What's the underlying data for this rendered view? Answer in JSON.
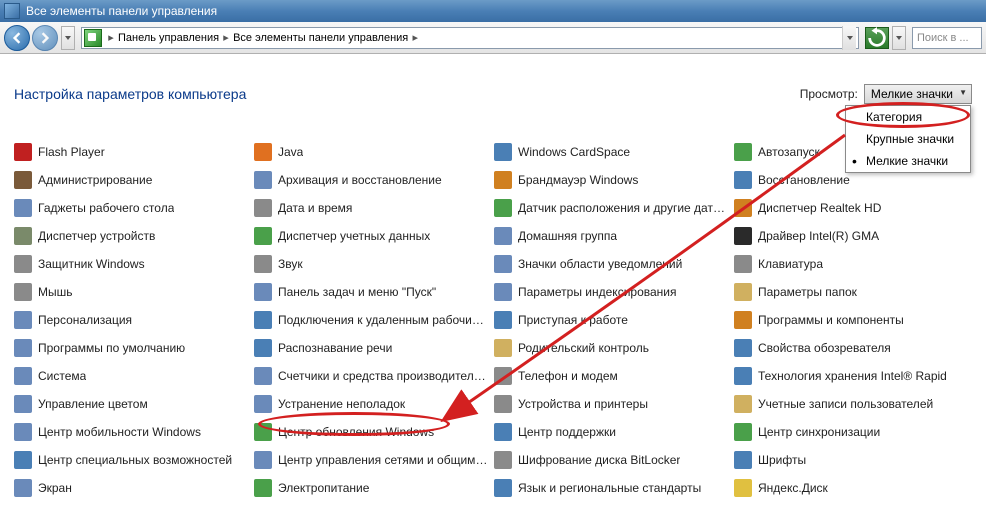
{
  "titlebar": {
    "title": "Все элементы панели управления"
  },
  "breadcrumb": {
    "seg1": "Панель управления",
    "seg2": "Все элементы панели управления"
  },
  "search": {
    "placeholder": "Поиск в ..."
  },
  "heading": "Настройка параметров компьютера",
  "view": {
    "label": "Просмотр:",
    "selected": "Мелкие значки",
    "menu": {
      "opt1": "Категория",
      "opt2": "Крупные значки",
      "opt3": "Мелкие значки"
    }
  },
  "items": [
    {
      "label": "Flash Player",
      "bg": "#c02020"
    },
    {
      "label": "Java",
      "bg": "#e07020"
    },
    {
      "label": "Windows CardSpace",
      "bg": "#4a7fb5"
    },
    {
      "label": "Автозапуск",
      "bg": "#4aa04a"
    },
    {
      "label": "Администрирование",
      "bg": "#7a5a3a"
    },
    {
      "label": "Архивация и восстановление",
      "bg": "#6a8aba"
    },
    {
      "label": "Брандмауэр Windows",
      "bg": "#d08020"
    },
    {
      "label": "Восстановление",
      "bg": "#4a7fb5"
    },
    {
      "label": "Гаджеты рабочего стола",
      "bg": "#6a8aba"
    },
    {
      "label": "Дата и время",
      "bg": "#8a8a8a"
    },
    {
      "label": "Датчик расположения и другие датч...",
      "bg": "#4aa04a"
    },
    {
      "label": "Диспетчер Realtek HD",
      "bg": "#d08020"
    },
    {
      "label": "Диспетчер устройств",
      "bg": "#7a8a6a"
    },
    {
      "label": "Диспетчер учетных данных",
      "bg": "#4aa04a"
    },
    {
      "label": "Домашняя группа",
      "bg": "#6a8aba"
    },
    {
      "label": "Драйвер Intel(R) GMA",
      "bg": "#2a2a2a"
    },
    {
      "label": "Защитник Windows",
      "bg": "#8a8a8a"
    },
    {
      "label": "Звук",
      "bg": "#8a8a8a"
    },
    {
      "label": "Значки области уведомлений",
      "bg": "#6a8aba"
    },
    {
      "label": "Клавиатура",
      "bg": "#8a8a8a"
    },
    {
      "label": "Мышь",
      "bg": "#8a8a8a"
    },
    {
      "label": "Панель задач и меню \"Пуск\"",
      "bg": "#6a8aba"
    },
    {
      "label": "Параметры индексирования",
      "bg": "#6a8aba"
    },
    {
      "label": "Параметры папок",
      "bg": "#d0b060"
    },
    {
      "label": "Персонализация",
      "bg": "#6a8aba"
    },
    {
      "label": "Подключения к удаленным рабочим с...",
      "bg": "#4a7fb5"
    },
    {
      "label": "Приступая к работе",
      "bg": "#4a7fb5"
    },
    {
      "label": "Программы и компоненты",
      "bg": "#d08020"
    },
    {
      "label": "Программы по умолчанию",
      "bg": "#6a8aba"
    },
    {
      "label": "Распознавание речи",
      "bg": "#4a7fb5"
    },
    {
      "label": "Родительский контроль",
      "bg": "#d0b060"
    },
    {
      "label": "Свойства обозревателя",
      "bg": "#4a7fb5"
    },
    {
      "label": "Система",
      "bg": "#6a8aba"
    },
    {
      "label": "Счетчики и средства производитель...",
      "bg": "#6a8aba"
    },
    {
      "label": "Телефон и модем",
      "bg": "#8a8a8a"
    },
    {
      "label": "Технология хранения Intel® Rapid",
      "bg": "#4a7fb5"
    },
    {
      "label": "Управление цветом",
      "bg": "#6a8aba"
    },
    {
      "label": "Устранение неполадок",
      "bg": "#6a8aba"
    },
    {
      "label": "Устройства и принтеры",
      "bg": "#8a8a8a"
    },
    {
      "label": "Учетные записи пользователей",
      "bg": "#d0b060"
    },
    {
      "label": "Центр мобильности Windows",
      "bg": "#6a8aba"
    },
    {
      "label": "Центр обновления Windows",
      "bg": "#4aa04a"
    },
    {
      "label": "Центр поддержки",
      "bg": "#4a7fb5"
    },
    {
      "label": "Центр синхронизации",
      "bg": "#4aa04a"
    },
    {
      "label": "Центр специальных возможностей",
      "bg": "#4a7fb5"
    },
    {
      "label": "Центр управления сетями и общим д...",
      "bg": "#6a8aba"
    },
    {
      "label": "Шифрование диска BitLocker",
      "bg": "#8a8a8a"
    },
    {
      "label": "Шрифты",
      "bg": "#4a7fb5"
    },
    {
      "label": "Экран",
      "bg": "#6a8aba"
    },
    {
      "label": "Электропитание",
      "bg": "#4aa04a"
    },
    {
      "label": "Язык и региональные стандарты",
      "bg": "#4a7fb5"
    },
    {
      "label": "Яндекс.Диск",
      "bg": "#e0c040"
    }
  ]
}
